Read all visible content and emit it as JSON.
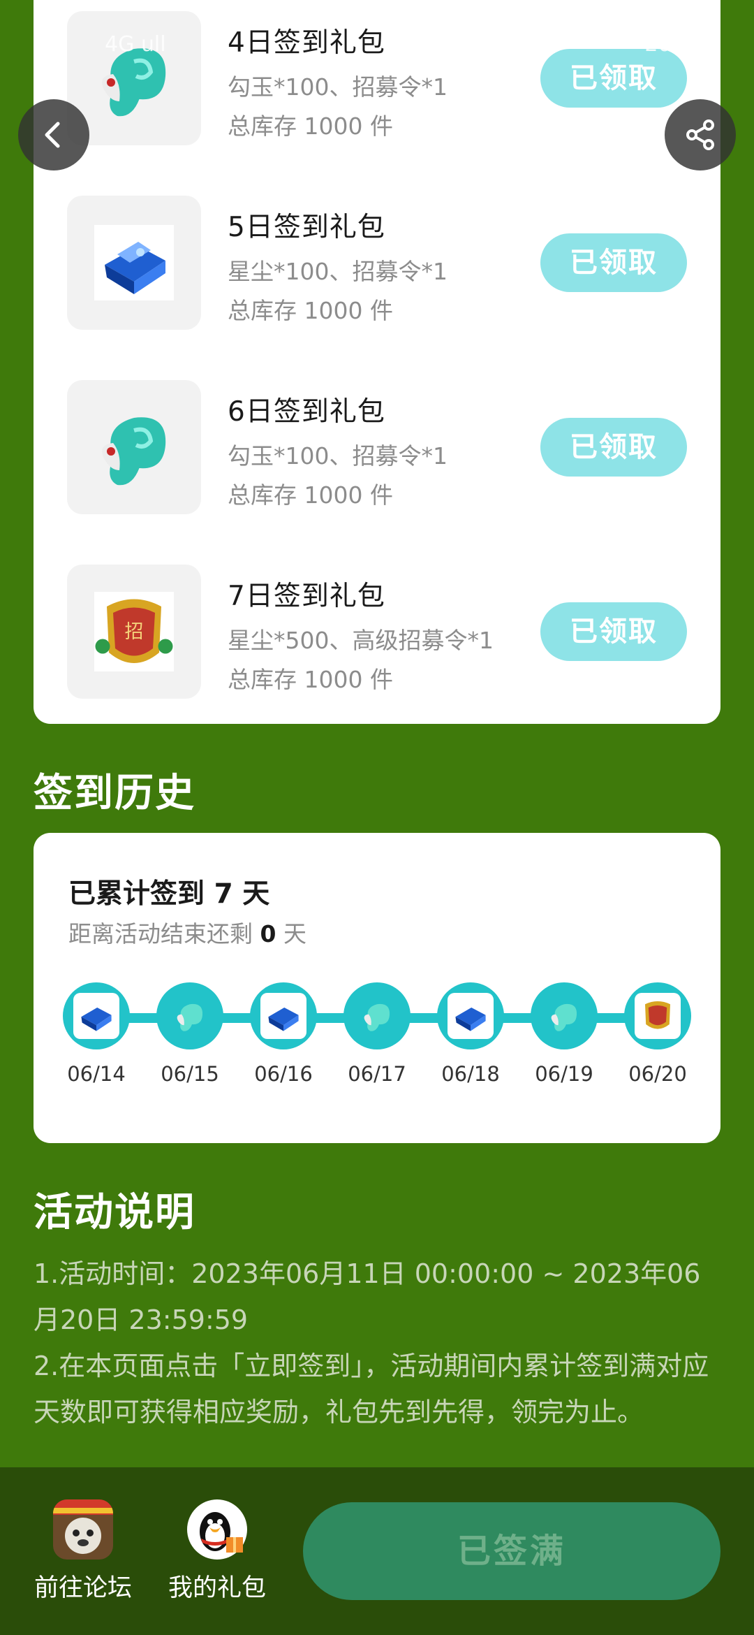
{
  "status_bar": {
    "left": "4G ull",
    "right": "20%"
  },
  "nav": {
    "back_icon": "chevron-left-icon",
    "share_icon": "share-icon"
  },
  "gifts": [
    {
      "title": "4日签到礼包",
      "desc": "勾玉*100、招募令*1",
      "stock": "总库存 1000 件",
      "button": "已领取",
      "icon": "jade-icon"
    },
    {
      "title": "5日签到礼包",
      "desc": "星尘*100、招募令*1",
      "stock": "总库存 1000 件",
      "button": "已领取",
      "icon": "stardust-chest-icon"
    },
    {
      "title": "6日签到礼包",
      "desc": "勾玉*100、招募令*1",
      "stock": "总库存 1000 件",
      "button": "已领取",
      "icon": "jade-icon"
    },
    {
      "title": "7日签到礼包",
      "desc": "星尘*500、高级招募令*1",
      "stock": "总库存 1000 件",
      "button": "已领取",
      "icon": "recruit-token-icon"
    }
  ],
  "history": {
    "section_title": "签到历史",
    "title": "已累计签到 7 天",
    "remaining_prefix": "距离活动结束还剩 ",
    "remaining_days": "0",
    "remaining_suffix": " 天",
    "days": [
      {
        "date": "06/14",
        "icon": "stardust-chest-icon"
      },
      {
        "date": "06/15",
        "icon": "jade-icon"
      },
      {
        "date": "06/16",
        "icon": "stardust-chest-icon"
      },
      {
        "date": "06/17",
        "icon": "jade-icon"
      },
      {
        "date": "06/18",
        "icon": "stardust-chest-icon"
      },
      {
        "date": "06/19",
        "icon": "jade-icon"
      },
      {
        "date": "06/20",
        "icon": "recruit-token-icon"
      }
    ]
  },
  "description": {
    "section_title": "活动说明",
    "line1": "1.活动时间：2023年06月11日 00:00:00 ~ 2023年06月20日 23:59:59",
    "line2": "2.在本页面点击「立即签到」，活动期间内累计签到满对应天数即可获得相应奖励，礼包先到先得，领完为止。"
  },
  "bottom": {
    "forum_label": "前往论坛",
    "gifts_label": "我的礼包",
    "signed_button": "已签满"
  },
  "colors": {
    "background": "#3f7a0b",
    "claim_button": "#8ee3e7",
    "timeline": "#22c3c9",
    "signed_button": "#2f8a5f"
  }
}
